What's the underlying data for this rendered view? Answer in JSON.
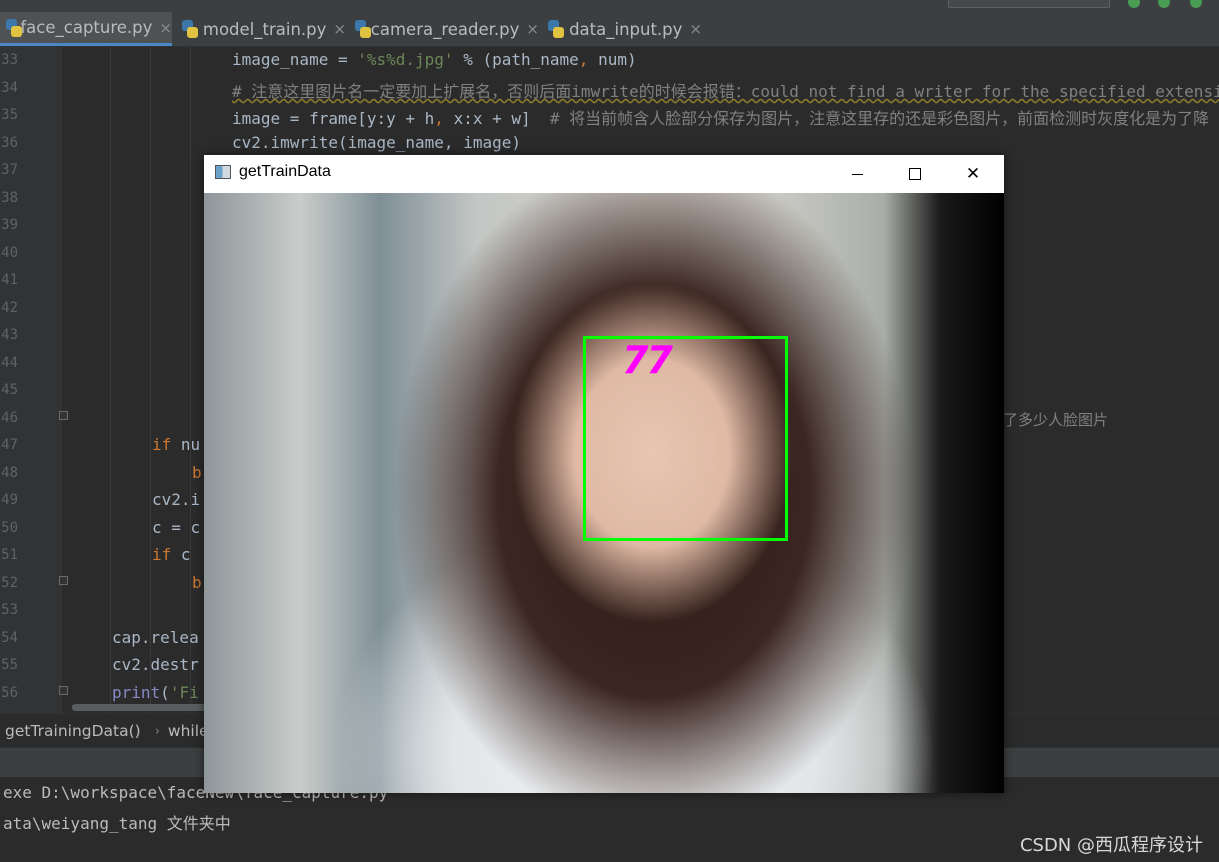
{
  "tabs": [
    {
      "label": "face_capture.py",
      "active": true
    },
    {
      "label": "model_train.py",
      "active": false
    },
    {
      "label": "camera_reader.py",
      "active": false
    },
    {
      "label": "data_input.py",
      "active": false
    }
  ],
  "tab_close_glyph": "×",
  "line_numbers": [
    "33",
    "34",
    "35",
    "36",
    "37",
    "38",
    "39",
    "40",
    "41",
    "42",
    "43",
    "44",
    "45",
    "46",
    "47",
    "48",
    "49",
    "50",
    "51",
    "52",
    "53",
    "54",
    "55",
    "56"
  ],
  "code": {
    "l33": {
      "a": "image_name = ",
      "b": "'%s%d.jpg'",
      "c": " % (path_name",
      "d": ",",
      "e": " num)"
    },
    "l34": "# 注意这里图片名一定要加上扩展名，否则后面imwrite的时候会报错：could not find a writer for the specified extension",
    "l35": {
      "a": "image = frame[y:y + h",
      "b": ",",
      "c": " x:x + w]  ",
      "d": "# 将当前帧含人脸部分保存为图片，注意这里存的还是彩色图片，前面检测时灰度化是为了降"
    },
    "l36": "cv2.imwrite(image_name, image)",
    "l46_tail": "了多少人脸图片",
    "l47": {
      "kw": "if",
      "rest": " nu"
    },
    "l48": "b",
    "l49": "cv2.i",
    "l50": "c = c",
    "l51": {
      "kw": "if",
      "rest": " c "
    },
    "l52": "b",
    "l54": "cap.relea",
    "l55": "cv2.destr",
    "l56": {
      "fn": "print",
      "rest": "(",
      "str": "'Fi"
    }
  },
  "breadcrumb": {
    "func": "getTrainingData()",
    "sep": "›",
    "stmt": "while"
  },
  "console": {
    "line1": "exe D:\\workspace\\faceNew\\face_capture.py",
    "line2": "ata\\weiyang_tang 文件夹中"
  },
  "watermark": "CSDN @西瓜程序设计",
  "cv_window": {
    "title": "getTrainData",
    "count_label": "77",
    "box_color": "#00ff00",
    "text_color": "#ff00ff"
  },
  "window_controls": {
    "close": "✕"
  }
}
